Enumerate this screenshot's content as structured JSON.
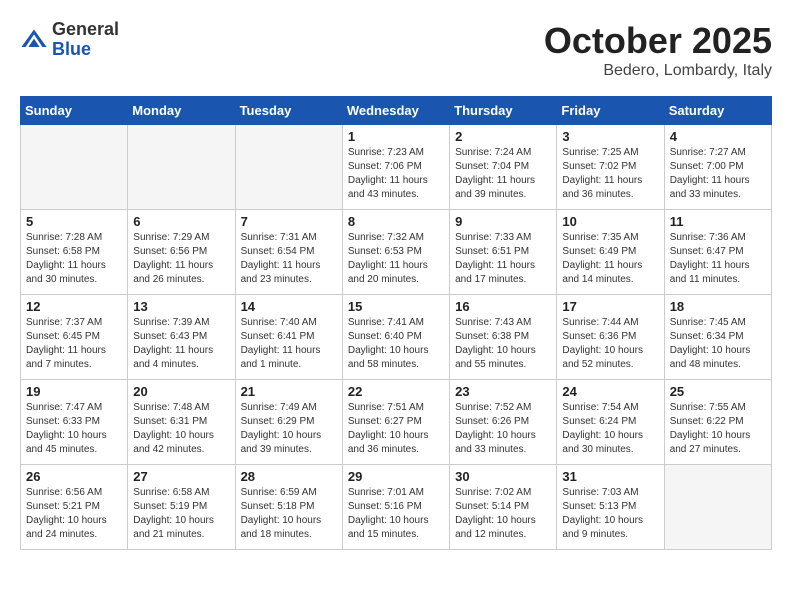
{
  "logo": {
    "general": "General",
    "blue": "Blue"
  },
  "title": "October 2025",
  "location": "Bedero, Lombardy, Italy",
  "days_of_week": [
    "Sunday",
    "Monday",
    "Tuesday",
    "Wednesday",
    "Thursday",
    "Friday",
    "Saturday"
  ],
  "weeks": [
    [
      {
        "day": "",
        "sunrise": "",
        "sunset": "",
        "daylight": "",
        "empty": true
      },
      {
        "day": "",
        "sunrise": "",
        "sunset": "",
        "daylight": "",
        "empty": true
      },
      {
        "day": "",
        "sunrise": "",
        "sunset": "",
        "daylight": "",
        "empty": true
      },
      {
        "day": "1",
        "sunrise": "Sunrise: 7:23 AM",
        "sunset": "Sunset: 7:06 PM",
        "daylight": "Daylight: 11 hours and 43 minutes.",
        "empty": false
      },
      {
        "day": "2",
        "sunrise": "Sunrise: 7:24 AM",
        "sunset": "Sunset: 7:04 PM",
        "daylight": "Daylight: 11 hours and 39 minutes.",
        "empty": false
      },
      {
        "day": "3",
        "sunrise": "Sunrise: 7:25 AM",
        "sunset": "Sunset: 7:02 PM",
        "daylight": "Daylight: 11 hours and 36 minutes.",
        "empty": false
      },
      {
        "day": "4",
        "sunrise": "Sunrise: 7:27 AM",
        "sunset": "Sunset: 7:00 PM",
        "daylight": "Daylight: 11 hours and 33 minutes.",
        "empty": false
      }
    ],
    [
      {
        "day": "5",
        "sunrise": "Sunrise: 7:28 AM",
        "sunset": "Sunset: 6:58 PM",
        "daylight": "Daylight: 11 hours and 30 minutes.",
        "empty": false
      },
      {
        "day": "6",
        "sunrise": "Sunrise: 7:29 AM",
        "sunset": "Sunset: 6:56 PM",
        "daylight": "Daylight: 11 hours and 26 minutes.",
        "empty": false
      },
      {
        "day": "7",
        "sunrise": "Sunrise: 7:31 AM",
        "sunset": "Sunset: 6:54 PM",
        "daylight": "Daylight: 11 hours and 23 minutes.",
        "empty": false
      },
      {
        "day": "8",
        "sunrise": "Sunrise: 7:32 AM",
        "sunset": "Sunset: 6:53 PM",
        "daylight": "Daylight: 11 hours and 20 minutes.",
        "empty": false
      },
      {
        "day": "9",
        "sunrise": "Sunrise: 7:33 AM",
        "sunset": "Sunset: 6:51 PM",
        "daylight": "Daylight: 11 hours and 17 minutes.",
        "empty": false
      },
      {
        "day": "10",
        "sunrise": "Sunrise: 7:35 AM",
        "sunset": "Sunset: 6:49 PM",
        "daylight": "Daylight: 11 hours and 14 minutes.",
        "empty": false
      },
      {
        "day": "11",
        "sunrise": "Sunrise: 7:36 AM",
        "sunset": "Sunset: 6:47 PM",
        "daylight": "Daylight: 11 hours and 11 minutes.",
        "empty": false
      }
    ],
    [
      {
        "day": "12",
        "sunrise": "Sunrise: 7:37 AM",
        "sunset": "Sunset: 6:45 PM",
        "daylight": "Daylight: 11 hours and 7 minutes.",
        "empty": false
      },
      {
        "day": "13",
        "sunrise": "Sunrise: 7:39 AM",
        "sunset": "Sunset: 6:43 PM",
        "daylight": "Daylight: 11 hours and 4 minutes.",
        "empty": false
      },
      {
        "day": "14",
        "sunrise": "Sunrise: 7:40 AM",
        "sunset": "Sunset: 6:41 PM",
        "daylight": "Daylight: 11 hours and 1 minute.",
        "empty": false
      },
      {
        "day": "15",
        "sunrise": "Sunrise: 7:41 AM",
        "sunset": "Sunset: 6:40 PM",
        "daylight": "Daylight: 10 hours and 58 minutes.",
        "empty": false
      },
      {
        "day": "16",
        "sunrise": "Sunrise: 7:43 AM",
        "sunset": "Sunset: 6:38 PM",
        "daylight": "Daylight: 10 hours and 55 minutes.",
        "empty": false
      },
      {
        "day": "17",
        "sunrise": "Sunrise: 7:44 AM",
        "sunset": "Sunset: 6:36 PM",
        "daylight": "Daylight: 10 hours and 52 minutes.",
        "empty": false
      },
      {
        "day": "18",
        "sunrise": "Sunrise: 7:45 AM",
        "sunset": "Sunset: 6:34 PM",
        "daylight": "Daylight: 10 hours and 48 minutes.",
        "empty": false
      }
    ],
    [
      {
        "day": "19",
        "sunrise": "Sunrise: 7:47 AM",
        "sunset": "Sunset: 6:33 PM",
        "daylight": "Daylight: 10 hours and 45 minutes.",
        "empty": false
      },
      {
        "day": "20",
        "sunrise": "Sunrise: 7:48 AM",
        "sunset": "Sunset: 6:31 PM",
        "daylight": "Daylight: 10 hours and 42 minutes.",
        "empty": false
      },
      {
        "day": "21",
        "sunrise": "Sunrise: 7:49 AM",
        "sunset": "Sunset: 6:29 PM",
        "daylight": "Daylight: 10 hours and 39 minutes.",
        "empty": false
      },
      {
        "day": "22",
        "sunrise": "Sunrise: 7:51 AM",
        "sunset": "Sunset: 6:27 PM",
        "daylight": "Daylight: 10 hours and 36 minutes.",
        "empty": false
      },
      {
        "day": "23",
        "sunrise": "Sunrise: 7:52 AM",
        "sunset": "Sunset: 6:26 PM",
        "daylight": "Daylight: 10 hours and 33 minutes.",
        "empty": false
      },
      {
        "day": "24",
        "sunrise": "Sunrise: 7:54 AM",
        "sunset": "Sunset: 6:24 PM",
        "daylight": "Daylight: 10 hours and 30 minutes.",
        "empty": false
      },
      {
        "day": "25",
        "sunrise": "Sunrise: 7:55 AM",
        "sunset": "Sunset: 6:22 PM",
        "daylight": "Daylight: 10 hours and 27 minutes.",
        "empty": false
      }
    ],
    [
      {
        "day": "26",
        "sunrise": "Sunrise: 6:56 AM",
        "sunset": "Sunset: 5:21 PM",
        "daylight": "Daylight: 10 hours and 24 minutes.",
        "empty": false
      },
      {
        "day": "27",
        "sunrise": "Sunrise: 6:58 AM",
        "sunset": "Sunset: 5:19 PM",
        "daylight": "Daylight: 10 hours and 21 minutes.",
        "empty": false
      },
      {
        "day": "28",
        "sunrise": "Sunrise: 6:59 AM",
        "sunset": "Sunset: 5:18 PM",
        "daylight": "Daylight: 10 hours and 18 minutes.",
        "empty": false
      },
      {
        "day": "29",
        "sunrise": "Sunrise: 7:01 AM",
        "sunset": "Sunset: 5:16 PM",
        "daylight": "Daylight: 10 hours and 15 minutes.",
        "empty": false
      },
      {
        "day": "30",
        "sunrise": "Sunrise: 7:02 AM",
        "sunset": "Sunset: 5:14 PM",
        "daylight": "Daylight: 10 hours and 12 minutes.",
        "empty": false
      },
      {
        "day": "31",
        "sunrise": "Sunrise: 7:03 AM",
        "sunset": "Sunset: 5:13 PM",
        "daylight": "Daylight: 10 hours and 9 minutes.",
        "empty": false
      },
      {
        "day": "",
        "sunrise": "",
        "sunset": "",
        "daylight": "",
        "empty": true
      }
    ]
  ]
}
